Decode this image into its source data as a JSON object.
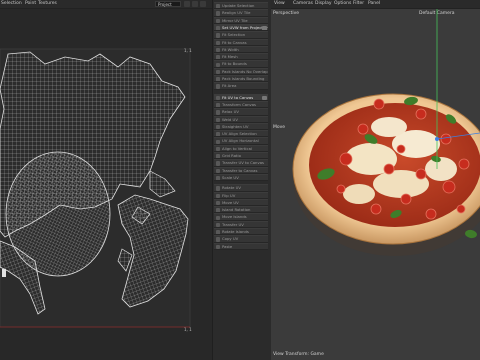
{
  "uv_editor": {
    "menu": [
      "Selection",
      "Point",
      "Textures"
    ],
    "projection_select": "Project",
    "corner_label_top_right": "1, 1",
    "corner_label_bottom_right": "1, 1"
  },
  "tool_panel": {
    "buttons": [
      {
        "label": "Update Selection",
        "highlight": false
      },
      {
        "label": "Realign UV Tile",
        "highlight": false
      },
      {
        "label": "Mirror UV Tile",
        "highlight": false
      },
      {
        "label": "Set UVW from Projection",
        "highlight": true
      },
      {
        "label": "Fit Selection",
        "highlight": false
      },
      {
        "label": "Fit to Canvas",
        "highlight": false
      },
      {
        "label": "Fit Width",
        "highlight": false
      },
      {
        "label": "Fit Mesh",
        "highlight": false
      },
      {
        "label": "Fit to Bounds",
        "highlight": false
      },
      {
        "label": "Pack Islands No Overlap",
        "highlight": false
      },
      {
        "label": "Pack Islands Bounding",
        "highlight": false
      },
      {
        "label": "Fit Area",
        "highlight": false
      },
      {
        "label": "Fit UV to Canvas",
        "highlight": true
      },
      {
        "label": "Transform Canvas",
        "highlight": false
      },
      {
        "label": "Relax UV",
        "highlight": false
      },
      {
        "label": "Weld UV",
        "highlight": false
      },
      {
        "label": "Straighten UV",
        "highlight": false
      },
      {
        "label": "UV Align Selection",
        "highlight": false
      },
      {
        "label": "UV Align Horizontal",
        "highlight": false
      },
      {
        "label": "Align to Vertical",
        "highlight": false
      },
      {
        "label": "Grid Ratio",
        "highlight": false
      },
      {
        "label": "Transfer UV to Canvas",
        "highlight": false
      },
      {
        "label": "Transfer to Canvas",
        "highlight": false
      },
      {
        "label": "Scale UV",
        "highlight": false
      },
      {
        "label": "Rotate UV",
        "highlight": false
      },
      {
        "label": "Flip UV",
        "highlight": false
      },
      {
        "label": "Move UV",
        "highlight": false
      },
      {
        "label": "Island Rotation",
        "highlight": false
      },
      {
        "label": "Move Islands",
        "highlight": false
      },
      {
        "label": "Transfer UV",
        "highlight": false
      },
      {
        "label": "Rotate Islands",
        "highlight": false
      },
      {
        "label": "Copy UV",
        "highlight": false
      },
      {
        "label": "Paste",
        "highlight": false
      }
    ]
  },
  "viewport": {
    "menu": [
      "View",
      "Cameras",
      "Display",
      "Options",
      "Filter",
      "Panel"
    ],
    "projection_label": "Perspective",
    "camera_label": "Default Camera",
    "left_label": "Move",
    "status_label": "View Transform: Game"
  },
  "colors": {
    "uv_bg": "#282828",
    "wire": "#d8d8d8",
    "viewport_bg": "#3b3b3b",
    "axis_green": "#46c25a",
    "axis_blue": "#3d7fe0",
    "crust": "#e2b98a",
    "sauce": "#b8361d",
    "cheese": "#f4e6c9",
    "tomato": "#c72c1e",
    "basil": "#3f7d2a"
  }
}
